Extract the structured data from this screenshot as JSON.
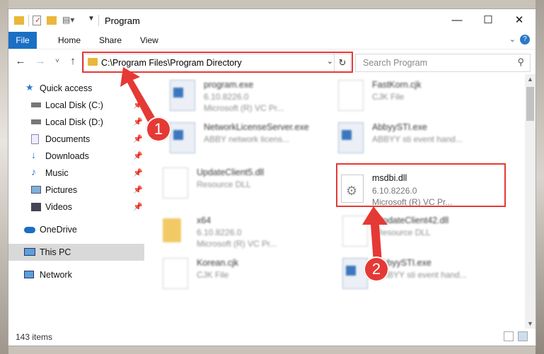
{
  "window": {
    "title": "Program"
  },
  "ribbon": {
    "tabs": [
      "File",
      "Home",
      "Share",
      "View"
    ]
  },
  "nav": {
    "address_path": "C:\\Program Files\\Program Directory",
    "search_placeholder": "Search Program"
  },
  "sidebar": {
    "items": [
      {
        "label": "Quick access",
        "icon": "star-icon"
      },
      {
        "label": "Local Disk (C:)",
        "icon": "drive-icon"
      },
      {
        "label": "Local Disk (D:)",
        "icon": "drive-icon"
      },
      {
        "label": "Documents",
        "icon": "documents-icon"
      },
      {
        "label": "Downloads",
        "icon": "download-icon"
      },
      {
        "label": "Music",
        "icon": "music-icon"
      },
      {
        "label": "Pictures",
        "icon": "pictures-icon"
      },
      {
        "label": "Videos",
        "icon": "videos-icon"
      },
      {
        "label": "OneDrive",
        "icon": "cloud-icon"
      },
      {
        "label": "This PC",
        "icon": "computer-icon"
      },
      {
        "label": "Network",
        "icon": "network-icon"
      }
    ]
  },
  "files": [
    {
      "name": "program.exe",
      "line1": "6.10.8226.0",
      "line2": "Microsoft (R) VC Pr...",
      "type": "exe"
    },
    {
      "name": "FastKorn.cjk",
      "line1": "CJK File",
      "line2": "",
      "type": "doc"
    },
    {
      "name": "NetworkLicenseServer.exe",
      "line1": "ABBY network licens...",
      "line2": "",
      "type": "exe"
    },
    {
      "name": "AbbyySTI.exe",
      "line1": "ABBYY sti event hand...",
      "line2": "",
      "type": "exe"
    },
    {
      "name": "UpdateClient5.dll",
      "line1": "Resource DLL",
      "line2": "",
      "type": "dll"
    },
    {
      "name": "msdbi.dll",
      "line1": "6.10.8226.0",
      "line2": "Microsoft (R) VC Pr...",
      "type": "dll"
    },
    {
      "name": "x64",
      "line1": "6.10.8226.0",
      "line2": "Microsoft (R) VC Pr...",
      "type": "folder"
    },
    {
      "name": "UpdateClient42.dll",
      "line1": "Resource DLL",
      "line2": "",
      "type": "dll"
    },
    {
      "name": "Korean.cjk",
      "line1": "CJK File",
      "line2": "",
      "type": "doc"
    },
    {
      "name": "AbbyySTI.exe",
      "line1": "ABBYY sti event hand...",
      "line2": "",
      "type": "exe"
    }
  ],
  "status": {
    "item_count": "143 items"
  },
  "annotations": {
    "badge1": "1",
    "badge2": "2",
    "accent": "#e53935"
  }
}
